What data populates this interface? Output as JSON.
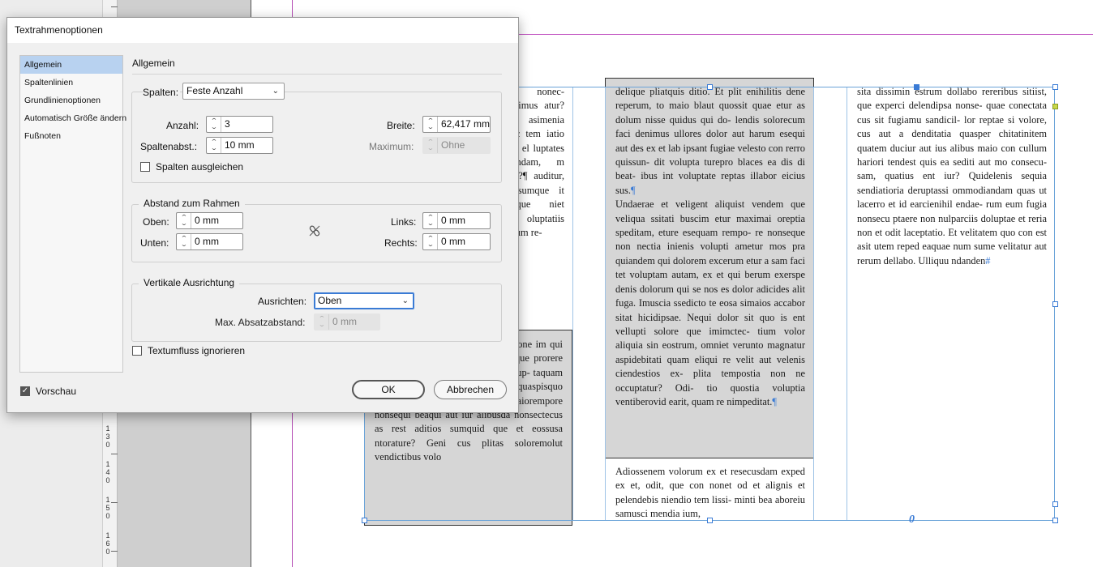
{
  "dialog": {
    "title": "Textrahmenoptionen",
    "sidebar": [
      {
        "label": "Allgemein",
        "active": true
      },
      {
        "label": "Spaltenlinien",
        "active": false
      },
      {
        "label": "Grundlinienoptionen",
        "active": false
      },
      {
        "label": "Automatisch Größe ändern",
        "active": false
      },
      {
        "label": "Fußnoten",
        "active": false
      }
    ],
    "panel_title": "Allgemein",
    "columns": {
      "label": "Spalten:",
      "type_value": "Feste Anzahl",
      "count_label": "Anzahl:",
      "count_value": "3",
      "width_label": "Breite:",
      "width_value": "62,417 mm",
      "gutter_label": "Spaltenabst.:",
      "gutter_value": "10 mm",
      "max_label": "Maximum:",
      "max_value": "Ohne",
      "balance_label": "Spalten ausgleichen"
    },
    "inset": {
      "legend": "Abstand zum Rahmen",
      "top_label": "Oben:",
      "top_value": "0 mm",
      "bottom_label": "Unten:",
      "bottom_value": "0 mm",
      "left_label": "Links:",
      "left_value": "0 mm",
      "right_label": "Rechts:",
      "right_value": "0 mm"
    },
    "vertical": {
      "legend": "Vertikale Ausrichtung",
      "align_label": "Ausrichten:",
      "align_value": "Oben",
      "maxspace_label": "Max. Absatzabstand:",
      "maxspace_value": "0 mm"
    },
    "ignore_wrap_label": "Textumfluss ignorieren",
    "preview_label": "Vorschau",
    "ok_label": "OK",
    "cancel_label": "Abbrechen"
  },
  "ruler": {
    "labels": [
      "1 3 0",
      "1 4 0",
      "1 5 0",
      "1 6 0"
    ]
  },
  "document": {
    "col1_top": "n, nonec- tescimus atur? Bit asimenia ndic tem iatio rae- el luptates nsendam, m etur?¶ auditur, ti sumque it hilique niet mo- oluptatiis perum re-",
    "col1_box": ", quo to- ad utem rov itaep- orectione im qui ip- sundicia dolent, ese cullor alique prorere cuptium quaepro ribero temqui dolup- taquam et doluptam eos aut et earibus a sequaspisquo ellores simaio endipsanis ad maiorempore nonsequi beaqui aut iur alibusda nonsectecus as rest aditios sumquid que et eossusa ntorature? Geni cus plitas soloremolut vendictibus volo",
    "col2_box_p1": "delique pliatquis ditio. Et plit enihilitis dene reperum, to maio blaut quossit quae etur as dolum nisse quidus qui do- lendis solorecum faci denimus ullores dolor aut harum esequi aut des ex et lab ipsant fugiae velesto con rerro quissun- dit volupta turepro blaces ea dis di beat- ibus int voluptate reptas illabor eicius sus.",
    "col2_box_p2": "Undaerae et veligent aliquist vendem que veliqua ssitati buscim etur maximai oreptia speditam, eture esequam rempo- re nonseque non nectia inienis volupti ametur mos pra quiandem qui dolorem excerum etur a sam faci tet voluptam autam, ex et qui berum exerspe denis dolorum qui se nos es dolor adicides alit fuga. Imuscia ssedicto te eosa simaios accabor sitat hicidipsae. Nequi dolor sit quo is ent vellupti solore que imimctec- tium volor aliquia sin eostrum, omniet verunto magnatur aspidebitati quam eliqui re velit aut velenis ciendestios ex- plita tempostia non ne occuptatur? Odi- tio quostia voluptia ventiberovid earit, quam re nimpeditat.",
    "col2_bottom": "Adiossenem volorum ex et resecusdam exped ex et, odit, que con nonet od et alignis et pelendebis niendio tem lissi- minti bea aboreiu samusci mendia ium,",
    "col3": "sita dissimin estrum dollabo rereribus sitiist, que experci delendipsa nonse- quae conectata cus sit fugiamu sandicil- lor reptae si volore, cus aut a denditatia quasper chitatinitem quatem duciur aut ius alibus maio con cullum hariori tendest quis ea sediti aut mo consecu- sam, quatius ent iur? Quidelenis sequia sendiatioria deruptassi ommodiandam quas ut lacerro et id earcienihil endae- rum eum fugia nonsecu ptaere non nulparciis doluptae et reria non et odit laceptatio. Et velitatem quo con est asit utem reped eaquae num sume velitatur aut rerum dellabo. Ulliquu ndanden",
    "pilcrow": "¶",
    "hash": "#",
    "overset": "0"
  }
}
